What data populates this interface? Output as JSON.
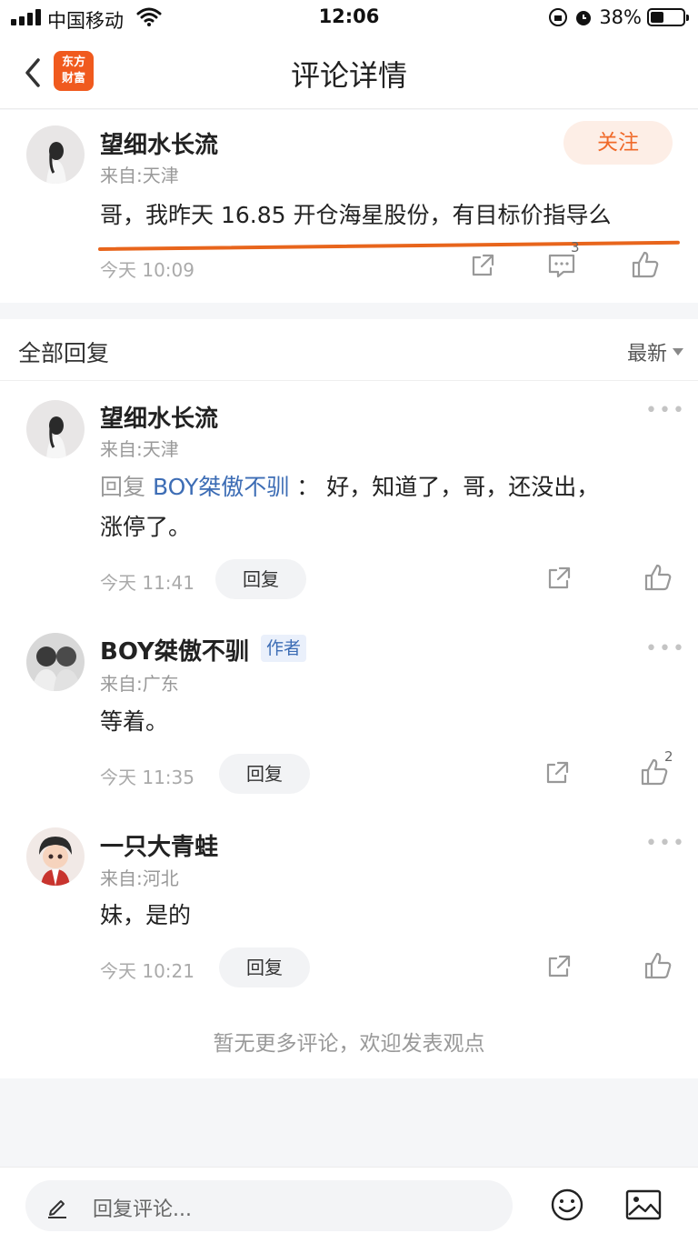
{
  "status_bar": {
    "carrier": "中国移动",
    "time": "12:06",
    "battery": "38%"
  },
  "nav": {
    "title": "评论详情",
    "logo_text": "东方财富"
  },
  "post": {
    "username": "望细水长流",
    "from": "来自:天津",
    "follow_label": "关注",
    "content": "哥，我昨天 16.85 开仓海星股份，有目标价指导么",
    "time": "今天 10:09",
    "comment_count": "3"
  },
  "replies": {
    "title": "全部回复",
    "sort": "最新",
    "items": [
      {
        "username": "望细水长流",
        "from": "来自:天津",
        "prefix": "回复",
        "target": "BOY桀傲不驯",
        "separator": "：",
        "content_line1": "好，知道了，哥，还没出，",
        "content_line2": "涨停了。",
        "time": "今天 11:41",
        "reply_label": "回复"
      },
      {
        "username": "BOY桀傲不驯",
        "badge": "作者",
        "from": "来自:广东",
        "content": "等着。",
        "time": "今天 11:35",
        "reply_label": "回复",
        "likes": "2"
      },
      {
        "username": "一只大青蛙",
        "from": "来自:河北",
        "content": "妹，是的",
        "time": "今天 10:21",
        "reply_label": "回复"
      }
    ],
    "no_more": "暂无更多评论，欢迎发表观点"
  },
  "bottom": {
    "placeholder": "回复评论..."
  },
  "colors": {
    "accent": "#f06a2a",
    "link": "#3d6db5",
    "highlight_line": "#e8651c"
  },
  "icons": [
    "signal-icon",
    "wifi-icon",
    "lock-rotation-icon",
    "alarm-icon",
    "battery-icon",
    "back-icon",
    "share-icon",
    "comment-icon",
    "like-icon",
    "more-icon",
    "pencil-icon",
    "emoji-icon",
    "image-icon",
    "sort-caret-icon"
  ]
}
